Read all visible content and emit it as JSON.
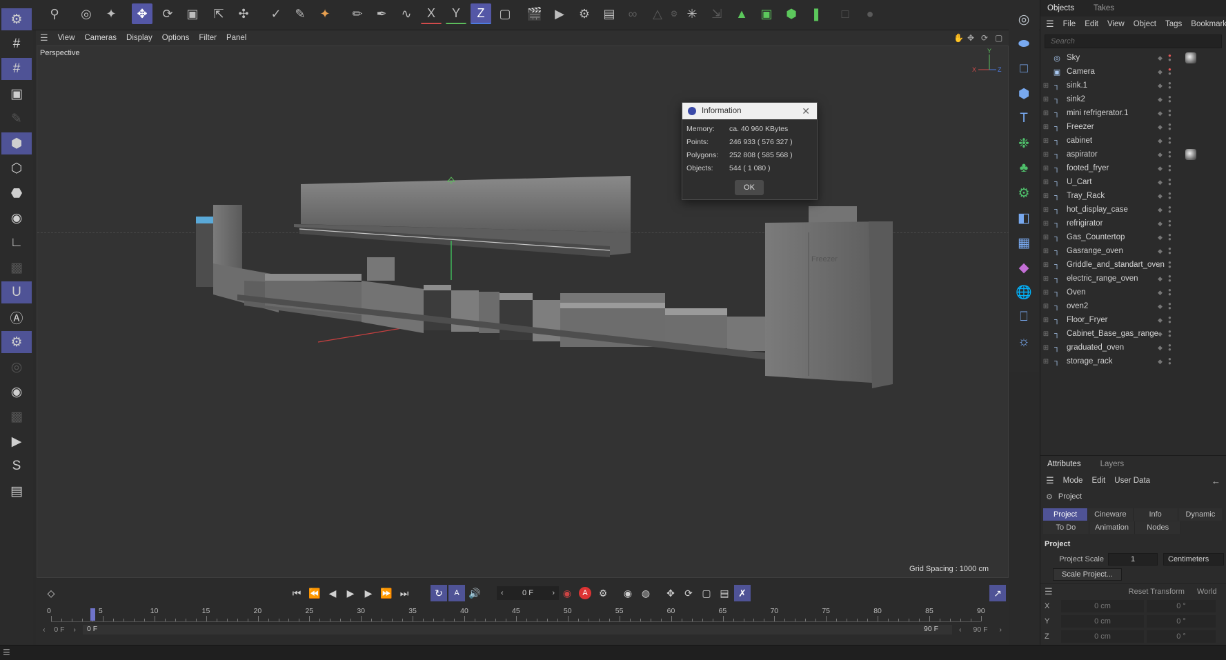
{
  "toolbar": {
    "icons": [
      "search-icon",
      "live-selection-icon",
      "selection-filter-icon",
      "move-icon",
      "rotate-icon",
      "scale-icon",
      "transform-icon",
      "move-children-icon",
      "polygon-pen-icon",
      "brush-icon",
      "knife-icon",
      "paint-icon",
      "spline-pen-icon",
      "spline-sketch-icon",
      "lock-x-axis-icon",
      "lock-y-axis-icon",
      "lock-z-axis-icon",
      "coordinate-system-icon",
      "render-view-icon",
      "render-picture-viewer-icon",
      "render-settings-icon",
      "edit-render-settings-icon",
      "snap-icon",
      "workplane-icon",
      "enable-axis-icon",
      "tweak-icon",
      "locked-workplane-icon",
      "green-triangle-icon",
      "green-cube-icon",
      "green-cube-2-icon",
      "green-bone-icon",
      "hidden-icon",
      "joint-icon"
    ],
    "axis_labels": {
      "x": "X",
      "y": "Y",
      "z": "Z"
    }
  },
  "left_toolbar": {
    "icons": [
      "settings-icon",
      "grid-icon",
      "grid-active-icon",
      "model-icon",
      "brush-dim-icon",
      "cube-mode-icon",
      "edges-icon",
      "polygons-icon",
      "points-icon",
      "axis-icon",
      "texture-dim-icon",
      "magnet-icon",
      "text-tool-icon",
      "gear-active-icon",
      "dim-tool-icon",
      "eye-icon",
      "render-dim-icon",
      "play-render-icon",
      "s-tool-icon",
      "folder-icon"
    ]
  },
  "viewport": {
    "menu": [
      "View",
      "Cameras",
      "Display",
      "Options",
      "Filter",
      "Panel"
    ],
    "camera_label": "Perspective",
    "grid_spacing": "Grid Spacing : 1000 cm",
    "axis": {
      "x": "X",
      "y": "Y",
      "z": "Z"
    },
    "scene_label": "Freezer"
  },
  "dialog": {
    "title": "Information",
    "rows": [
      {
        "k": "Memory:",
        "v": "ca. 40 960 KBytes"
      },
      {
        "k": "Points:",
        "v": "246 933 ( 576 327 )"
      },
      {
        "k": "Polygons:",
        "v": "252 808 ( 585 568 )"
      },
      {
        "k": "Objects:",
        "v": "544 ( 1 080 )"
      }
    ],
    "ok": "OK"
  },
  "objects": {
    "tabs": [
      "Objects",
      "Takes"
    ],
    "menu": [
      "File",
      "Edit",
      "View",
      "Object",
      "Tags",
      "Bookmarks"
    ],
    "search_placeholder": "Search",
    "items": [
      {
        "name": "Sky",
        "icon": "sky-icon",
        "expand": false,
        "tag": true,
        "red": true
      },
      {
        "name": "Camera",
        "icon": "camera-icon",
        "expand": false,
        "tag": false,
        "red": true
      },
      {
        "name": "sink.1",
        "icon": "null-icon",
        "expand": true
      },
      {
        "name": "sink2",
        "icon": "null-icon",
        "expand": true
      },
      {
        "name": "mini refrigerator.1",
        "icon": "null-icon",
        "expand": true
      },
      {
        "name": "Freezer",
        "icon": "null-icon",
        "expand": true
      },
      {
        "name": "cabinet",
        "icon": "null-icon",
        "expand": true
      },
      {
        "name": "aspirator",
        "icon": "null-icon",
        "expand": true,
        "tag": true
      },
      {
        "name": "footed_fryer",
        "icon": "null-icon",
        "expand": true
      },
      {
        "name": "U_Cart",
        "icon": "null-icon",
        "expand": true
      },
      {
        "name": "Tray_Rack",
        "icon": "null-icon",
        "expand": true
      },
      {
        "name": "hot_display_case",
        "icon": "null-icon",
        "expand": true
      },
      {
        "name": "refrigirator",
        "icon": "null-icon",
        "expand": true
      },
      {
        "name": "Gas_Countertop",
        "icon": "null-icon",
        "expand": true
      },
      {
        "name": "Gasrange_oven",
        "icon": "null-icon",
        "expand": true
      },
      {
        "name": "Griddle_and_standart_oven",
        "icon": "null-icon",
        "expand": true
      },
      {
        "name": "electric_range_oven",
        "icon": "null-icon",
        "expand": true
      },
      {
        "name": "Oven",
        "icon": "null-icon",
        "expand": true
      },
      {
        "name": "oven2",
        "icon": "null-icon",
        "expand": true
      },
      {
        "name": "Floor_Fryer",
        "icon": "null-icon",
        "expand": true
      },
      {
        "name": "Cabinet_Base_gas_range",
        "icon": "null-icon",
        "expand": true
      },
      {
        "name": "graduated_oven",
        "icon": "null-icon",
        "expand": true
      },
      {
        "name": "storage_rack",
        "icon": "null-icon",
        "expand": true
      }
    ]
  },
  "attributes": {
    "tabs": [
      "Attributes",
      "Layers"
    ],
    "menu": [
      "Mode",
      "Edit",
      "User Data"
    ],
    "object": "Project",
    "ptabs_row1": [
      "Project",
      "Cineware",
      "Info",
      "Dynamic"
    ],
    "ptabs_row2": [
      "To Do",
      "Animation",
      "Nodes"
    ],
    "section": "Project",
    "scale_label": "Project Scale",
    "scale_value": "1",
    "scale_unit": "Centimeters",
    "scale_button": "Scale Project...",
    "reset_transform": "Reset Transform",
    "world": "World",
    "xyz": [
      {
        "axis": "X",
        "pos": "0 cm",
        "rot": "0 °"
      },
      {
        "axis": "Y",
        "pos": "0 cm",
        "rot": "0 °"
      },
      {
        "axis": "Z",
        "pos": "0 cm",
        "rot": "0 °"
      }
    ]
  },
  "timeline": {
    "current_frame": "0 F",
    "start_frame": "0 F",
    "range_start": "0 F",
    "range_end": "90 F",
    "end_frame": "90 F",
    "ticks": [
      "0",
      "5",
      "10",
      "15",
      "20",
      "25",
      "30",
      "35",
      "40",
      "45",
      "50",
      "55",
      "60",
      "65",
      "70",
      "75",
      "80",
      "85",
      "90"
    ],
    "playhead_frame": 4,
    "max_frame": 90
  }
}
